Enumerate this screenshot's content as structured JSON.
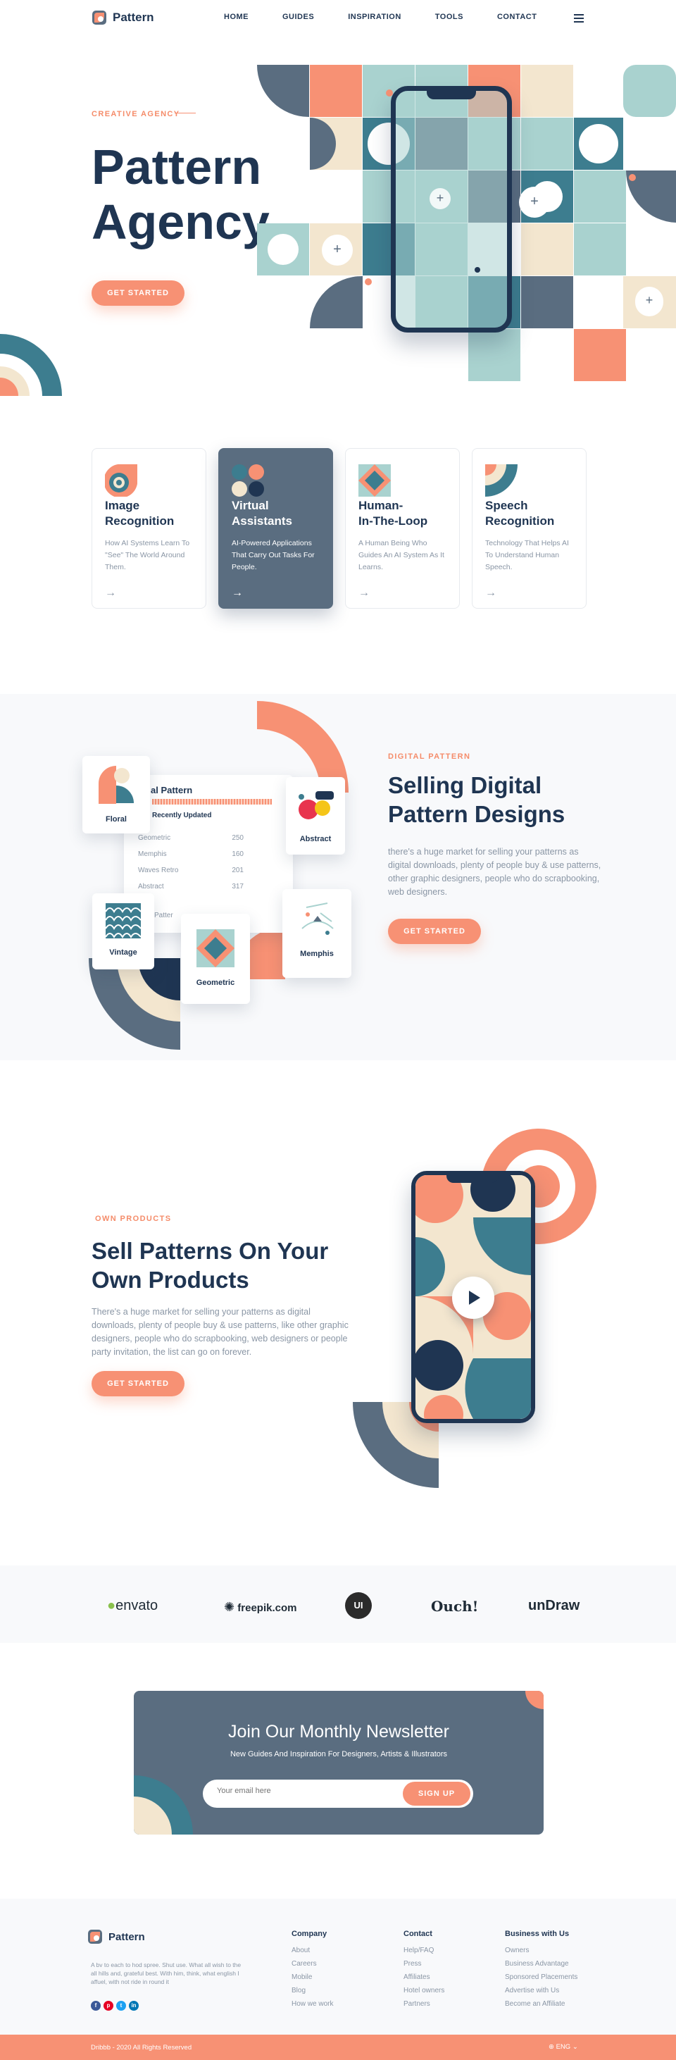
{
  "nav": {
    "brand": "Pattern",
    "links": [
      "HOME",
      "GUIDES",
      "INSPIRATION",
      "TOOLS",
      "CONTACT"
    ]
  },
  "hero": {
    "eyebrow": "CREATIVE AGENCY",
    "title_line1": "Pattern",
    "title_line2": "Agency",
    "cta": "GET STARTED"
  },
  "services": [
    {
      "title_l1": "Image",
      "title_l2": "Recognition",
      "desc": "How AI Systems Learn To \"See\" The World Around Them."
    },
    {
      "title_l1": "Virtual",
      "title_l2": "Assistants",
      "desc": "AI-Powered Applications That Carry Out Tasks For People."
    },
    {
      "title_l1": "Human-",
      "title_l2": "In-The-Loop",
      "desc": "A Human Being Who Guides An AI System As It Learns."
    },
    {
      "title_l1": "Speech",
      "title_l2": "Recognition",
      "desc": "Technology That Helps AI To Understand Human Speech."
    }
  ],
  "digital": {
    "eyebrow": "DIGITAL PATTERN",
    "title_l1": "Selling Digital",
    "title_l2": "Pattern Designs",
    "desc": "there's a huge market for selling your patterns as digital downloads, plenty of people buy & use patterns, other graphic designers, people who do scrapbooking, web designers.",
    "cta": "GET STARTED",
    "panel_title": "al Pattern",
    "panel_sub": "Recently Updated",
    "panel_footer": "l Patter",
    "rows": [
      {
        "name": "Geometric",
        "count": "250"
      },
      {
        "name": "Memphis",
        "count": "160"
      },
      {
        "name": "Waves Retro",
        "count": "201"
      },
      {
        "name": "Abstract",
        "count": "317"
      }
    ],
    "tiles": {
      "floral": "Floral",
      "abstract": "Abstract",
      "vintage": "Vintage",
      "geometric": "Geometric",
      "memphis": "Memphis"
    }
  },
  "products": {
    "eyebrow": "OWN PRODUCTS",
    "title_l1": "Sell Patterns On Your",
    "title_l2": "Own Products",
    "desc": "There's a huge market for selling your patterns as digital downloads, plenty of people buy & use patterns, like other graphic designers, people who do scrapbooking, web designers or people party invitation, the list can go on forever.",
    "cta": "GET STARTED"
  },
  "brands": [
    "envato",
    "freepik.com",
    "UI",
    "Ouch!",
    "unDraw"
  ],
  "newsletter": {
    "title": "Join Our Monthly Newsletter",
    "subtitle": "New Guides And Inspiration For Designers, Artists & Illustrators",
    "placeholder": "Your email here",
    "cta": "SIGN UP"
  },
  "footer": {
    "brand": "Pattern",
    "about": "A bv to each to hod spree. Shut use. What all wish to the all hills and, grateful best. With him, think, what english I affuel, with not ride in round it",
    "columns": [
      {
        "title": "Company",
        "links": [
          "About",
          "Careers",
          "Mobile",
          "Blog",
          "How we work"
        ]
      },
      {
        "title": "Contact",
        "links": [
          "Help/FAQ",
          "Press",
          "Affiliates",
          "Hotel owners",
          "Partners"
        ]
      },
      {
        "title": "Business with Us",
        "links": [
          "Owners",
          "Business Advantage",
          "Sponsored Placements",
          "Advertise with Us",
          "Become an Affiliate"
        ]
      }
    ],
    "copyright": "Dribbb - 2020 All Rights Reserved",
    "language": "ENG"
  },
  "colors": {
    "navy": "#1f3552",
    "coral": "#f79174",
    "teal": "#3d7d8f",
    "slate": "#5a6d80",
    "cream": "#f3e6cf",
    "mint": "#a9d2cf"
  }
}
